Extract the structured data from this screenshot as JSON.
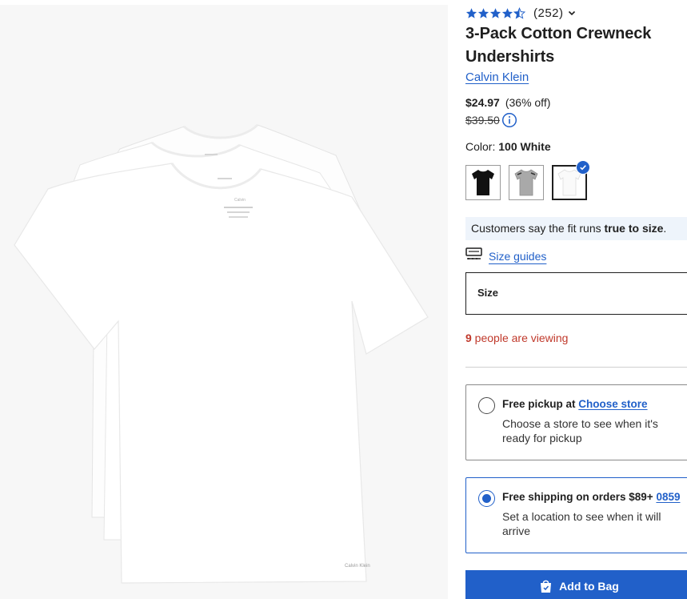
{
  "product": {
    "rating_value": 4.5,
    "rating_count": "(252)",
    "title": "3-Pack Cotton Crewneck Undershirts",
    "brand": "Calvin Klein",
    "image_label": "Calvin Klein",
    "image_tag_brand": "Calvin"
  },
  "price": {
    "current": "$24.97",
    "discount": "(36% off)",
    "original": "$39.50"
  },
  "color": {
    "label": "Color:",
    "value": "100 White",
    "swatches": [
      "black",
      "grey",
      "white"
    ],
    "selected_index": 2
  },
  "fit": {
    "prefix": "Customers say the fit runs ",
    "emphasis": "true to size",
    "suffix": "."
  },
  "size": {
    "guides_label": "Size guides",
    "select_label": "Size"
  },
  "viewing": {
    "count": "9",
    "text": " people are viewing"
  },
  "fulfillment": {
    "pickup": {
      "title": "Free pickup at ",
      "link": "Choose store",
      "desc": "Choose a store to see when it's ready for pickup",
      "selected": false
    },
    "shipping": {
      "title": "Free shipping on orders $89+ ",
      "link": "0859",
      "desc": "Set a location to see when it will arrive",
      "selected": true
    }
  },
  "cta": {
    "add_to_bag": "Add to Bag"
  },
  "colors": {
    "accent": "#2160c9",
    "alert": "#c0392b",
    "fit_bg": "#eef4fb"
  }
}
